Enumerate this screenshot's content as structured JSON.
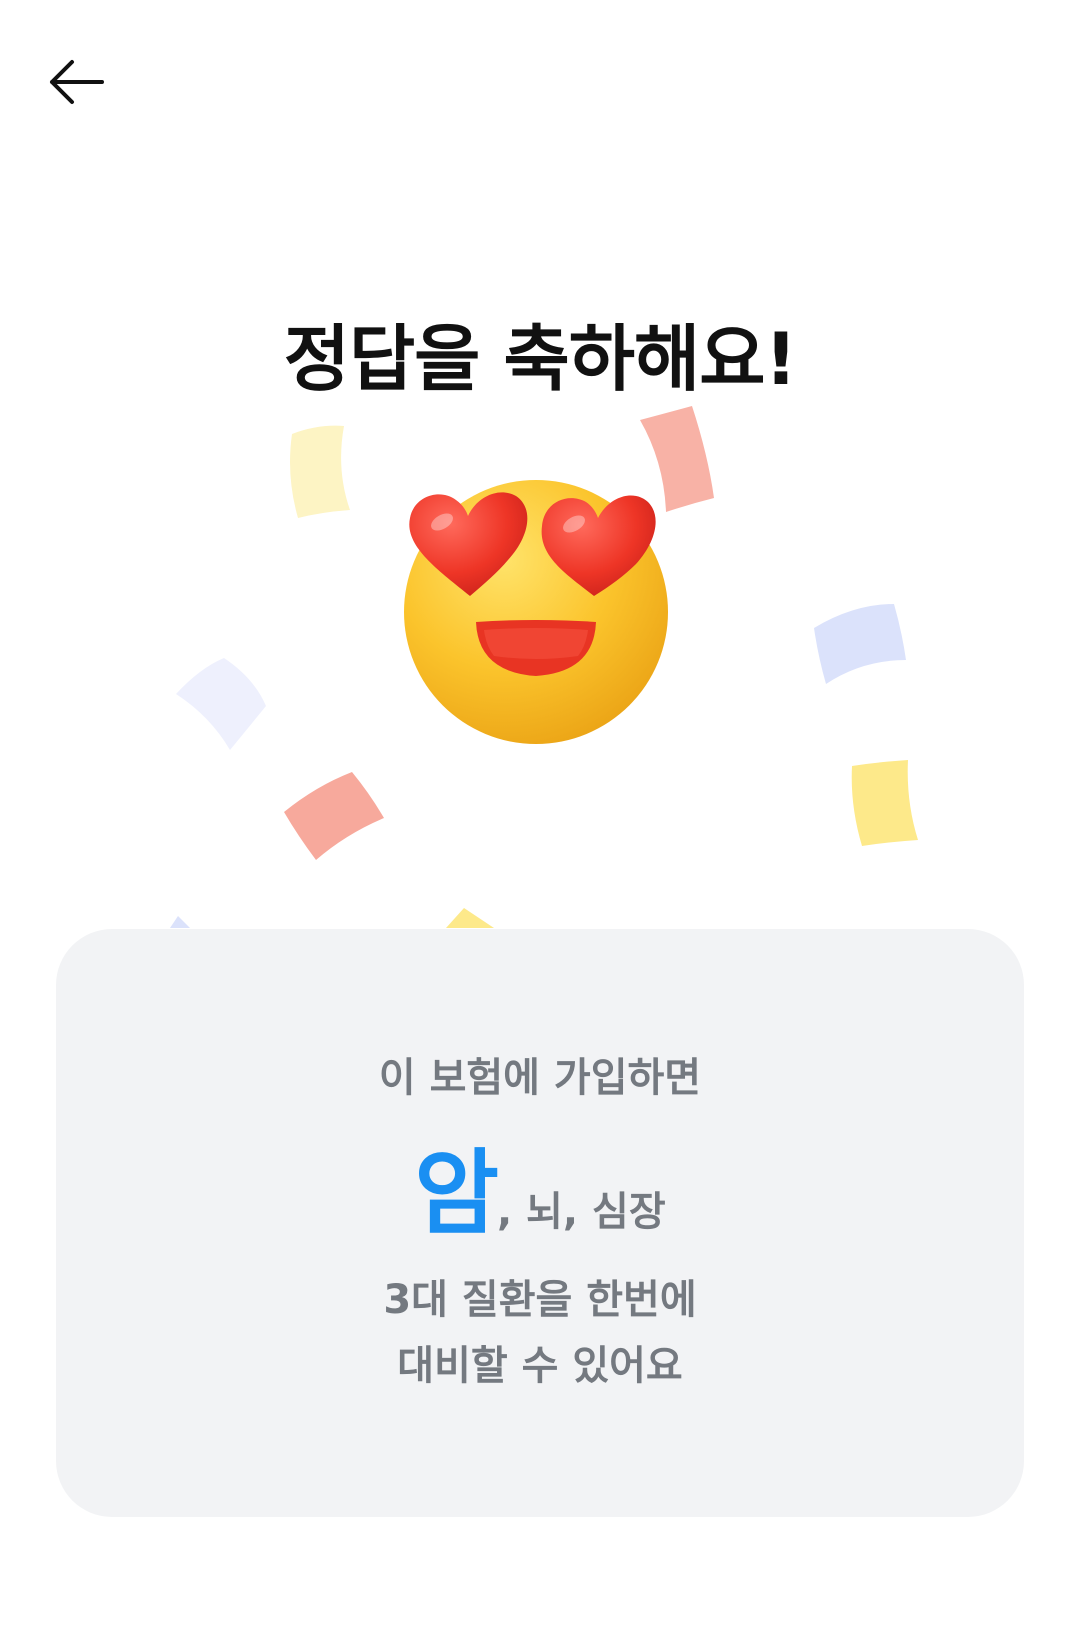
{
  "header": {
    "back_icon": "arrow-left-icon"
  },
  "title": "정답을 축하해요!",
  "hero": {
    "emoji_icon": "heart-eyes-face-icon",
    "confetti_colors": [
      "#fbe9a8",
      "#f7a99c",
      "#d7def8",
      "#fbe06a",
      "#eceffd"
    ]
  },
  "card": {
    "line1": "이 보험에 가입하면",
    "highlight": "암",
    "highlight_rest": ", 뇌, 심장",
    "line3": "3대 질환을 한번에",
    "line4": "대비할 수 있어요"
  },
  "colors": {
    "accent": "#1a8ff2",
    "card_bg": "#f2f3f5",
    "muted_text": "#747980",
    "title_text": "#111111"
  }
}
